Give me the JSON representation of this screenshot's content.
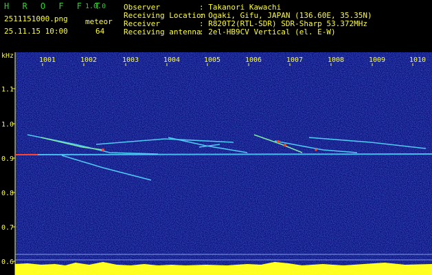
{
  "header": {
    "app_name": "H R O F F T",
    "version": "1.0.0",
    "filename": "2511151000.png",
    "datetime": "25.11.15 10:00",
    "meteor_label": "meteor",
    "meteor_count": "64",
    "info": [
      {
        "label": "Observer",
        "value": ": Takanori Kawachi"
      },
      {
        "label": "Receiving Location",
        "value": ": Ogaki, Gifu, JAPAN (136.60E, 35.35N)"
      },
      {
        "label": "Receiver",
        "value": ": R820T2(RTL-SDR) SDR-Sharp 53.372MHz"
      },
      {
        "label": "Receiving antenna",
        "value": ": 2el-HB9CV Vertical (el. E-W)"
      }
    ]
  },
  "spectrogram": {
    "unit_label": "kHz",
    "x_ticks": [
      "1001",
      "1002",
      "1003",
      "1004",
      "1005",
      "1006",
      "1007",
      "1008",
      "1009",
      "1010"
    ],
    "y_ticks": [
      "1.1",
      "1.0",
      "0.9",
      "0.8",
      "0.7",
      "0.6"
    ],
    "colors": {
      "background": "#0a0a72",
      "trace": "#55ddff",
      "hot": "#ff3322",
      "axis_text": "#ffff33",
      "header_text": "#2fd12f"
    }
  }
}
